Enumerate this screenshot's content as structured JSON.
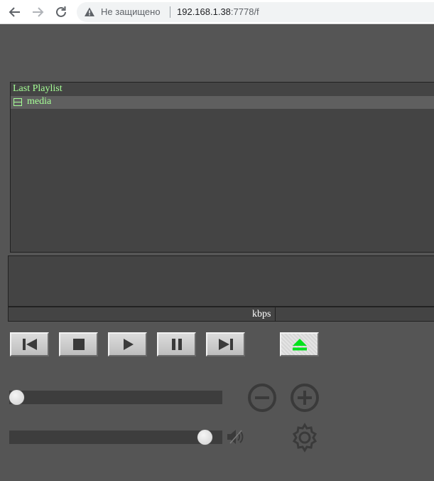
{
  "browser": {
    "security_text": "Не защищено",
    "url_host": "192.168.1.38",
    "url_rest": ":7778/f"
  },
  "playlist": {
    "title": "Last Playlist",
    "items": [
      {
        "label": "media",
        "icon": "folder-icon"
      }
    ]
  },
  "status": {
    "bitrate_unit": "kbps"
  },
  "controls": [
    {
      "name": "previous-button",
      "icon": "skip-previous-icon"
    },
    {
      "name": "stop-button",
      "icon": "stop-icon"
    },
    {
      "name": "play-button",
      "icon": "play-icon"
    },
    {
      "name": "pause-button",
      "icon": "pause-icon"
    },
    {
      "name": "next-button",
      "icon": "skip-next-icon"
    },
    {
      "name": "eject-button",
      "icon": "eject-icon"
    }
  ],
  "seek": {
    "position": 0.0
  },
  "volume": {
    "level": 0.95,
    "icon": "speaker-icon"
  },
  "colors": {
    "background": "#555555",
    "playlist_text": "#a6ff96",
    "eject_accent": "#00e21c",
    "icon_gray": "#3a3a3a"
  }
}
